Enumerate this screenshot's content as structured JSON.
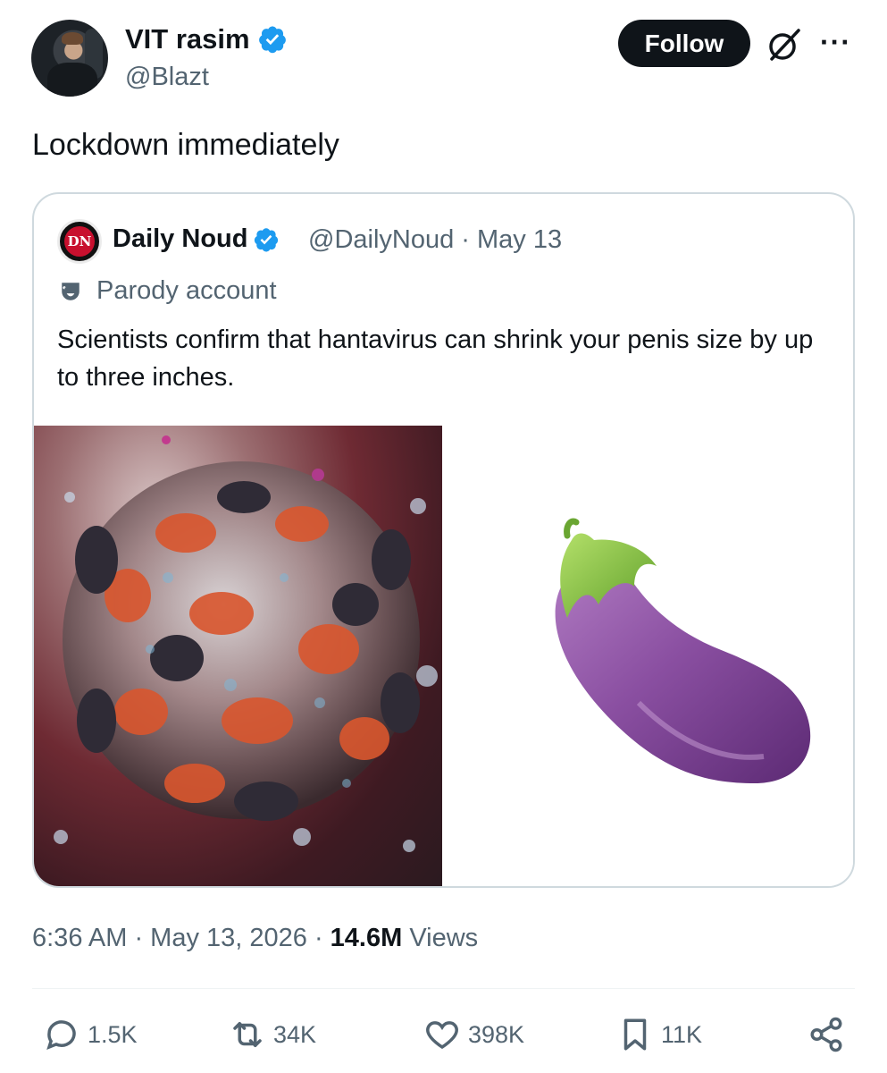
{
  "author": {
    "name": "VIT rasim",
    "handle": "@Blazt",
    "follow_label": "Follow"
  },
  "tweet": {
    "text": "Lockdown immediately"
  },
  "quoted": {
    "name": "Daily Noud",
    "meta": "@DailyNoud · May 13",
    "avatar_text": "DN",
    "parody_label": "Parody account",
    "text": "Scientists confirm that hantavirus can shrink your penis size by up to three inches."
  },
  "footer": {
    "time_date": "6:36 AM · May 13, 2026 · ",
    "views_count": "14.6M",
    "views_label": " Views"
  },
  "actions": {
    "replies": "1.5K",
    "reposts": "34K",
    "likes": "398K",
    "bookmarks": "11K"
  },
  "colors": {
    "verified": "#1d9bf0",
    "text_primary": "#0f1419",
    "text_secondary": "#536471",
    "border": "#cfd9de"
  },
  "icons": [
    "verified-badge-icon",
    "grok-icon",
    "more-icon",
    "parody-mask-icon",
    "reply-icon",
    "repost-icon",
    "like-icon",
    "bookmark-icon",
    "share-icon"
  ]
}
